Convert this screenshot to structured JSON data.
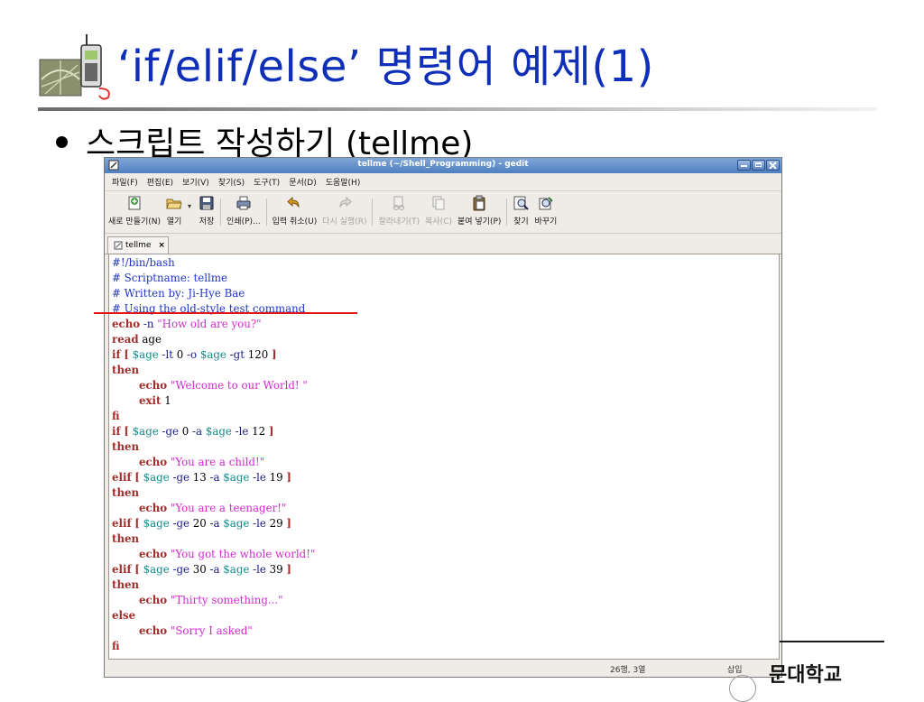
{
  "slide": {
    "title": "‘if/elif/else’ 명령어 예제(1)",
    "bullet": "스크립트 작성하기 (tellme)",
    "university_partial": "문대학교"
  },
  "window": {
    "title": "tellme (~/Shell_Programming) - gedit"
  },
  "menu": [
    "파일(F)",
    "편집(E)",
    "보기(V)",
    "찾기(S)",
    "도구(T)",
    "문서(D)",
    "도움말(H)"
  ],
  "toolbar": {
    "new": "새로 만들기(N)",
    "open": "열기",
    "save": "저장",
    "print": "인쇄(P)...",
    "undo": "입력 취소(U)",
    "redo": "다시 실행(R)",
    "cut": "잘라내기(T)",
    "copy": "복사(C)",
    "paste": "붙여 넣기(P)",
    "find": "찾기",
    "replace": "바꾸기"
  },
  "tab": {
    "label": "tellme",
    "close": "×"
  },
  "code_lines": [
    [
      [
        "c-comment",
        "#!/bin/bash"
      ]
    ],
    [
      [
        "c-comment",
        "# Scriptname: tellme"
      ]
    ],
    [
      [
        "c-comment",
        "# Written by: Ji-Hye Bae"
      ]
    ],
    [
      [
        "c-comment",
        "# Using the old-style test command"
      ]
    ],
    [
      [
        "c-kw",
        "echo"
      ],
      [
        "c-op",
        " -n "
      ],
      [
        "c-str",
        "\"How old are you?\""
      ]
    ],
    [
      [
        "c-kw",
        "read"
      ],
      [
        "",
        " age"
      ]
    ],
    [
      [
        "c-kw",
        "if"
      ],
      [
        "",
        " "
      ],
      [
        "c-kw",
        "["
      ],
      [
        "",
        " "
      ],
      [
        "c-var",
        "$age"
      ],
      [
        "c-op",
        " -lt "
      ],
      [
        "",
        "0"
      ],
      [
        "c-op",
        " -o "
      ],
      [
        "c-var",
        "$age"
      ],
      [
        "c-op",
        " -gt "
      ],
      [
        "",
        "120 "
      ],
      [
        "c-kw",
        "]"
      ]
    ],
    [
      [
        "c-kw",
        "then"
      ]
    ],
    [
      [
        "",
        "        "
      ],
      [
        "c-kw",
        "echo"
      ],
      [
        "",
        " "
      ],
      [
        "c-str",
        "\"Welcome to our World! \""
      ]
    ],
    [
      [
        "",
        "        "
      ],
      [
        "c-kw",
        "exit"
      ],
      [
        "",
        " 1"
      ]
    ],
    [
      [
        "c-kw",
        "fi"
      ]
    ],
    [
      [
        "c-kw",
        "if"
      ],
      [
        "",
        " "
      ],
      [
        "c-kw",
        "["
      ],
      [
        "",
        " "
      ],
      [
        "c-var",
        "$age"
      ],
      [
        "c-op",
        " -ge "
      ],
      [
        "",
        "0"
      ],
      [
        "c-op",
        " -a "
      ],
      [
        "c-var",
        "$age"
      ],
      [
        "c-op",
        " -le "
      ],
      [
        "",
        "12 "
      ],
      [
        "c-kw",
        "]"
      ]
    ],
    [
      [
        "c-kw",
        "then"
      ]
    ],
    [
      [
        "",
        "        "
      ],
      [
        "c-kw",
        "echo"
      ],
      [
        "",
        " "
      ],
      [
        "c-str",
        "\"You are a child!\""
      ]
    ],
    [
      [
        "c-kw",
        "elif"
      ],
      [
        "",
        " "
      ],
      [
        "c-kw",
        "["
      ],
      [
        "",
        " "
      ],
      [
        "c-var",
        "$age"
      ],
      [
        "c-op",
        " -ge "
      ],
      [
        "",
        "13"
      ],
      [
        "c-op",
        " -a "
      ],
      [
        "c-var",
        "$age"
      ],
      [
        "c-op",
        " -le "
      ],
      [
        "",
        "19 "
      ],
      [
        "c-kw",
        "]"
      ]
    ],
    [
      [
        "c-kw",
        "then"
      ]
    ],
    [
      [
        "",
        "        "
      ],
      [
        "c-kw",
        "echo"
      ],
      [
        "",
        " "
      ],
      [
        "c-str",
        "\"You are a teenager!\""
      ]
    ],
    [
      [
        "c-kw",
        "elif"
      ],
      [
        "",
        " "
      ],
      [
        "c-kw",
        "["
      ],
      [
        "",
        " "
      ],
      [
        "c-var",
        "$age"
      ],
      [
        "c-op",
        " -ge "
      ],
      [
        "",
        "20"
      ],
      [
        "c-op",
        " -a "
      ],
      [
        "c-var",
        "$age"
      ],
      [
        "c-op",
        " -le "
      ],
      [
        "",
        "29 "
      ],
      [
        "c-kw",
        "]"
      ]
    ],
    [
      [
        "c-kw",
        "then"
      ]
    ],
    [
      [
        "",
        "        "
      ],
      [
        "c-kw",
        "echo"
      ],
      [
        "",
        " "
      ],
      [
        "c-str",
        "\"You got the whole world!\""
      ]
    ],
    [
      [
        "c-kw",
        "elif"
      ],
      [
        "",
        " "
      ],
      [
        "c-kw",
        "["
      ],
      [
        "",
        " "
      ],
      [
        "c-var",
        "$age"
      ],
      [
        "c-op",
        " -ge "
      ],
      [
        "",
        "30"
      ],
      [
        "c-op",
        " -a "
      ],
      [
        "c-var",
        "$age"
      ],
      [
        "c-op",
        " -le "
      ],
      [
        "",
        "39 "
      ],
      [
        "c-kw",
        "]"
      ]
    ],
    [
      [
        "c-kw",
        "then"
      ]
    ],
    [
      [
        "",
        "        "
      ],
      [
        "c-kw",
        "echo"
      ],
      [
        "",
        " "
      ],
      [
        "c-str",
        "\"Thirty something...\""
      ]
    ],
    [
      [
        "c-kw",
        "else"
      ]
    ],
    [
      [
        "",
        "        "
      ],
      [
        "c-kw",
        "echo"
      ],
      [
        "",
        " "
      ],
      [
        "c-str",
        "\"Sorry I asked\""
      ]
    ],
    [
      [
        "c-kw",
        "fi"
      ]
    ]
  ],
  "status": {
    "position": "26행, 3열",
    "mode": "삽입"
  },
  "icons": {
    "slide_icon": "phone-globe-icon",
    "app_icon": "gedit-icon",
    "tab_icon": "document-icon"
  }
}
